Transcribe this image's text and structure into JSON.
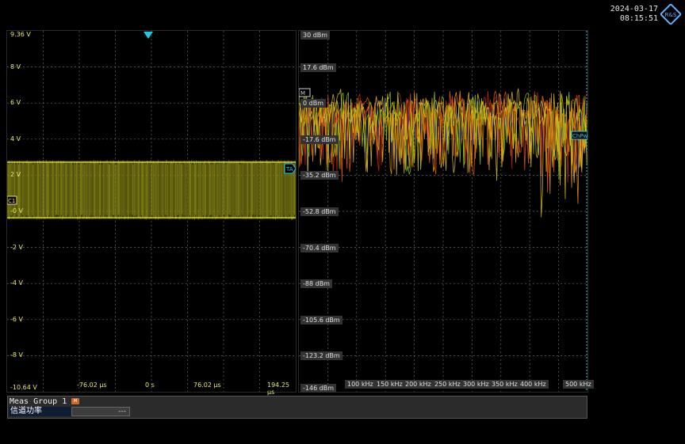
{
  "header": {
    "date": "2024-03-17",
    "time": "08:15:51",
    "logo_icon": "rohde-schwarz-logo"
  },
  "time_panel": {
    "y_labels": [
      "9.36 V",
      "8 V",
      "6 V",
      "4 V",
      "2 V",
      "-0 V",
      "-2 V",
      "-4 V",
      "-6 V",
      "-8 V",
      "-10.64 V"
    ],
    "x_labels": [
      "-76.02 µs",
      "0 s",
      "76.02 µs",
      "194.25 µs"
    ],
    "channel_marker": "C1",
    "trigger_marker": "TA",
    "trace_color": "#d8d820"
  },
  "spectrum_panel": {
    "y_labels": [
      "30 dBm",
      "17.6 dBm",
      "0 dBm",
      "-17.6 dBm",
      "-35.2 dBm",
      "-52.8 dBm",
      "-70.4 dBm",
      "-88 dBm",
      "-105.6 dBm",
      "-123.2 dBm",
      "-146 dBm"
    ],
    "x_labels": [
      "100 kHz",
      "150 kHz",
      "200 kHz",
      "250 kHz",
      "300 kHz",
      "350 kHz",
      "400 kHz",
      "500 kHz"
    ],
    "marker_left": "M",
    "marker_right": "ChPw",
    "colors": [
      "#e8c820",
      "#f0a010",
      "#f06010",
      "#c83010",
      "#8cd020"
    ]
  },
  "meas": {
    "title": "Meas Group 1",
    "badge": "M",
    "row_name": "信道功率",
    "row_value": "---"
  }
}
